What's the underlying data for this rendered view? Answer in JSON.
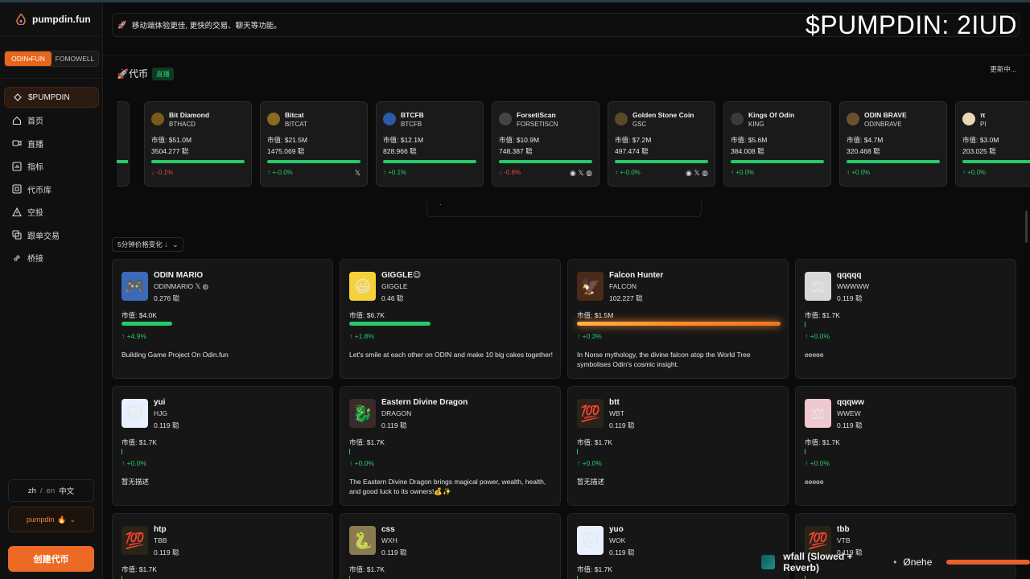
{
  "app": {
    "name": "pumpdin.fun",
    "watermark": "$PUMPDIN: 2IUD"
  },
  "sidebar": {
    "switch": [
      "ODIN•FUN",
      "FOMOWELL"
    ],
    "items": [
      {
        "label": "$PUMPDIN",
        "icon": "diamond-icon"
      },
      {
        "label": "首页",
        "icon": "home-icon"
      },
      {
        "label": "直播",
        "icon": "video-icon"
      },
      {
        "label": "指标",
        "icon": "chart-icon"
      },
      {
        "label": "代币库",
        "icon": "library-icon"
      },
      {
        "label": "空投",
        "icon": "airdrop-icon"
      },
      {
        "label": "跟单交易",
        "icon": "copy-trade-icon"
      },
      {
        "label": "桥接",
        "icon": "link-icon"
      }
    ],
    "lang": {
      "zh": "zh",
      "slash": "/",
      "en": "en",
      "current": "中文"
    },
    "user": "pumpdin",
    "create": "创建代币"
  },
  "banner": {
    "text": "移动端体验更佳, 更快的交易、聊天等功能。"
  },
  "tokens_section": {
    "title": "代币",
    "live": "直播",
    "updating": "更新中..."
  },
  "ticker": [
    {
      "name": "Bit Diamond",
      "symbol": "BTHACD",
      "mcap": "市值: $51.0M",
      "price": "3504.277 聪",
      "change": "↓ -0.1%",
      "dir": "down",
      "bar": 1.0,
      "socials": "",
      "logo": "#7a5a1a"
    },
    {
      "name": "Bitcat",
      "symbol": "BITCAT",
      "mcap": "市值: $21.5M",
      "price": "1475.069 聪",
      "change": "↑ +-0.0%",
      "dir": "up",
      "bar": 1.0,
      "socials": "𝕏",
      "logo": "#8a6a20"
    },
    {
      "name": "BTCFB",
      "symbol": "BTCFB",
      "mcap": "市值: $12.1M",
      "price": "828.966 聪",
      "change": "↑ +0.1%",
      "dir": "up",
      "bar": 1.0,
      "socials": "",
      "logo": "#2b5aa8"
    },
    {
      "name": "ForsetiScan",
      "symbol": "FORSETISCN",
      "mcap": "市值: $10.9M",
      "price": "748.387 聪",
      "change": "↓ -0.8%",
      "dir": "down",
      "bar": 1.0,
      "socials": "◉ 𝕏 ◍",
      "logo": "#444444"
    },
    {
      "name": "Golden Stone Coin",
      "symbol": "GSC",
      "mcap": "市值: $7.2M",
      "price": "497.474 聪",
      "change": "↑ +-0.0%",
      "dir": "up",
      "bar": 1.0,
      "socials": "◉ 𝕏 ◍",
      "logo": "#5a4a2a"
    },
    {
      "name": "Kings Of Odin",
      "symbol": "KING",
      "mcap": "市值: $5.6M",
      "price": "384.008 聪",
      "change": "↑ +0.0%",
      "dir": "up",
      "bar": 1.0,
      "socials": "",
      "logo": "#3a3a3a"
    },
    {
      "name": "ODIN BRAVE",
      "symbol": "ODINBRAVE",
      "mcap": "市值: $4.7M",
      "price": "320.468 聪",
      "change": "↑ +0.0%",
      "dir": "up",
      "bar": 1.0,
      "socials": "",
      "logo": "#6a5030"
    },
    {
      "name": "π",
      "symbol": "PI",
      "mcap": "市值: $3.0M",
      "price": "203.025 聪",
      "change": "↑ +0.0%",
      "dir": "up",
      "bar": 1.0,
      "socials": "",
      "logo": "#e8d8b8"
    }
  ],
  "carousel_dot": "·",
  "sort": {
    "label": "5分钟价格变化 ↓"
  },
  "grid": [
    {
      "name": "ODIN MARIO",
      "symbol": "ODINMARIO  𝕏 ◍",
      "price": "0.276 聪",
      "mcap": "市值: $4.0K",
      "change": "↑ +4.9%",
      "bar": 0.25,
      "bar_style": "green",
      "desc": "Building Game Project On Odin.fun",
      "img": "🎮",
      "img_bg": "#3a6ab8"
    },
    {
      "name": "GIGGLE😉",
      "symbol": "GIGGLE",
      "price": "0.46 聪",
      "mcap": "市值: $6.7K",
      "change": "↑ +1.8%",
      "bar": 0.4,
      "bar_style": "green",
      "desc": "Let's smile at each other on ODIN and make 10 big cakes together!",
      "img": "😃",
      "img_bg": "#f5d23a"
    },
    {
      "name": "Falcon Hunter",
      "symbol": "FALCON",
      "price": "102.227 聪",
      "mcap": "市值: $1.5M",
      "change": "↑ +0.3%",
      "bar": 1.0,
      "bar_style": "fire",
      "desc": "In Norse mythology, the divine falcon atop the World Tree symbolises Odin's cosmic insight.",
      "img": "🦅",
      "img_bg": "#4a2a18"
    },
    {
      "name": "qqqqq",
      "symbol": "WWWWW",
      "price": "0.119 聪",
      "mcap": "市值: $1.7K",
      "change": "↑ +0.0%",
      "bar": 0.0,
      "bar_style": "thin",
      "desc": "eeeee",
      "img": "⚖",
      "img_bg": "#d8d8d8"
    },
    {
      "name": "yui",
      "symbol": "HJG",
      "price": "0.119 聪",
      "mcap": "市值: $1.7K",
      "change": "↑ +0.0%",
      "bar": 0.0,
      "bar_style": "thin",
      "desc": "暂无描述",
      "img": "🐱",
      "img_bg": "#e8f0ff"
    },
    {
      "name": "Eastern Divine Dragon",
      "symbol": "DRAGON",
      "price": "0.119 聪",
      "mcap": "市值: $1.7K",
      "change": "↑ +0.0%",
      "bar": 0.0,
      "bar_style": "thin",
      "desc": "The Eastern Divine Dragon brings magical power, wealth, health, and good luck to its owners!💰✨",
      "img": "🐉",
      "img_bg": "#3a2a2a"
    },
    {
      "name": "btt",
      "symbol": "WBT",
      "price": "0.119 聪",
      "mcap": "市值: $1.7K",
      "change": "↑ +0.0%",
      "bar": 0.0,
      "bar_style": "thin",
      "desc": "暂无描述",
      "img": "💯",
      "img_bg": "#2a2418"
    },
    {
      "name": "qqqww",
      "symbol": "WWEW",
      "price": "0.119 聪",
      "mcap": "市值: $1.7K",
      "change": "↑ +0.0%",
      "bar": 0.0,
      "bar_style": "thin",
      "desc": "eeeee",
      "img": "⚖",
      "img_bg": "#f0c8d0"
    },
    {
      "name": "htp",
      "symbol": "TBB",
      "price": "0.119 聪",
      "mcap": "市值: $1.7K",
      "change": "",
      "bar": 0.0,
      "bar_style": "thin",
      "desc": "",
      "img": "💯",
      "img_bg": "#2a2418"
    },
    {
      "name": "css",
      "symbol": "WXH",
      "price": "0.119 聪",
      "mcap": "市值: $1.7K",
      "change": "",
      "bar": 0.0,
      "bar_style": "thin",
      "desc": "",
      "img": "🐍",
      "img_bg": "#8a7a50"
    },
    {
      "name": "yuo",
      "symbol": "WOK",
      "price": "0.119 聪",
      "mcap": "市值: $1.7K",
      "change": "",
      "bar": 0.0,
      "bar_style": "thin",
      "desc": "",
      "img": "🐱",
      "img_bg": "#e8f0ff"
    },
    {
      "name": "tbb",
      "symbol": "VTB",
      "price": "0.119 聪",
      "mcap": "",
      "change": "",
      "bar": 0.0,
      "bar_style": "thin",
      "desc": "",
      "img": "💯",
      "img_bg": "#2a2418"
    }
  ],
  "player": {
    "title": "wfall (Slowed + Reverb)",
    "sep": "•",
    "artist": "Ønehe"
  }
}
